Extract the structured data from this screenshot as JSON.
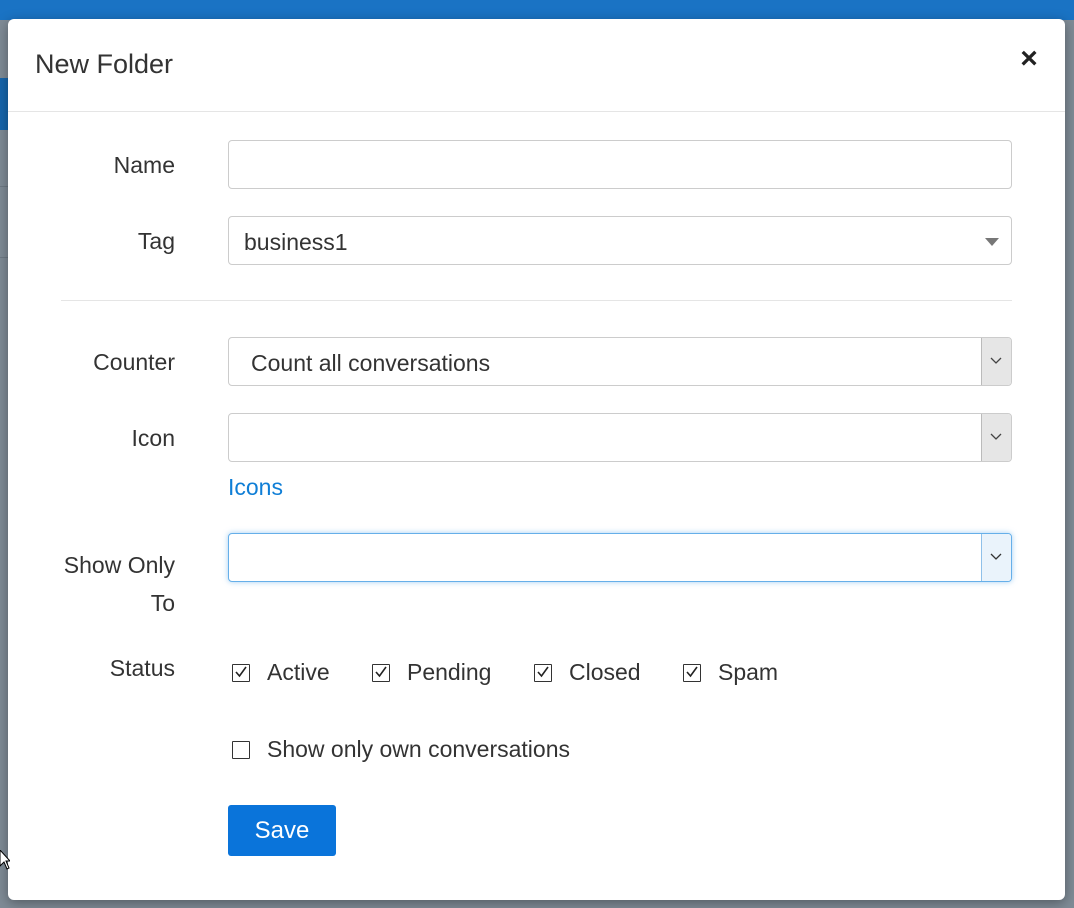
{
  "modal": {
    "title": "New Folder",
    "close_symbol": "×"
  },
  "form": {
    "name": {
      "label": "Name",
      "value": ""
    },
    "tag": {
      "label": "Tag",
      "value": "business1"
    },
    "counter": {
      "label": "Counter",
      "value": "Count all conversations"
    },
    "icon": {
      "label": "Icon",
      "value": "",
      "link": "Icons"
    },
    "show_only_to": {
      "label_line1": "Show Only",
      "label_line2": "To",
      "value": ""
    },
    "status": {
      "label": "Status",
      "options": [
        {
          "label": "Active",
          "checked": true
        },
        {
          "label": "Pending",
          "checked": true
        },
        {
          "label": "Closed",
          "checked": true
        },
        {
          "label": "Spam",
          "checked": true
        }
      ]
    },
    "own_only": {
      "label": "Show only own conversations",
      "checked": false
    },
    "save_label": "Save"
  },
  "colors": {
    "accent": "#0a74da",
    "link": "#0f7ed6",
    "topbar": "#1a73c4"
  }
}
